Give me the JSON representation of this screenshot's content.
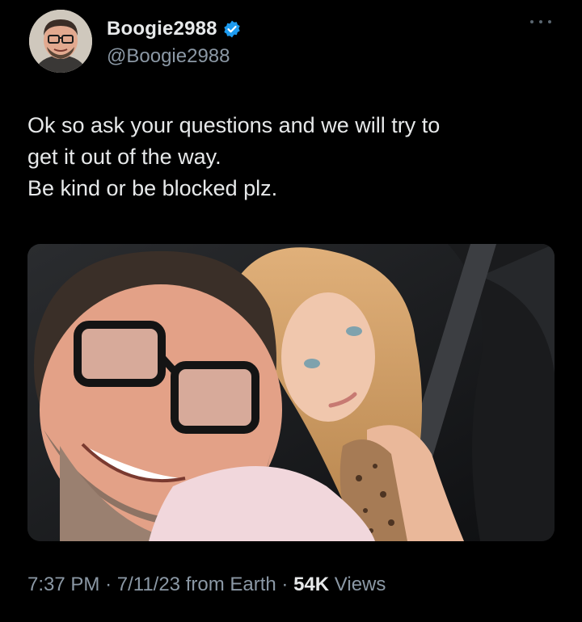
{
  "author": {
    "display_name": "Boogie2988",
    "handle": "@Boogie2988",
    "verified": true,
    "avatar_icon": "user-avatar"
  },
  "tweet": {
    "lines": [
      "Ok so ask your questions and we will try to",
      "get it out of the way.",
      "Be kind or be blocked plz."
    ]
  },
  "media": {
    "type": "photo"
  },
  "meta": {
    "time": "7:37 PM",
    "separator": "·",
    "date": "7/11/23",
    "source": "from Earth",
    "views_count": "54K",
    "views_label": "Views"
  },
  "icons": {
    "verified": "verified-badge-icon",
    "more": "more-options-icon"
  },
  "colors": {
    "background": "#000000",
    "text_primary": "#e7e9ea",
    "text_secondary": "#8b98a5",
    "verified_blue": "#1d9bf0"
  }
}
